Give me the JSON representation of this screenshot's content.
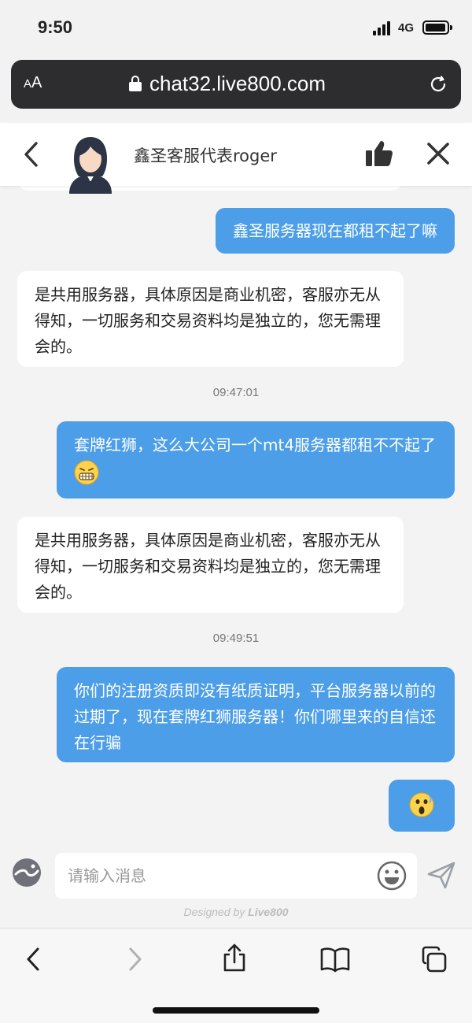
{
  "status_bar": {
    "time": "9:50",
    "network": "4G"
  },
  "browser": {
    "text_size_small": "A",
    "text_size_large": "A",
    "url": "chat32.live800.com"
  },
  "chat_header": {
    "agent_name": "鑫圣客服代表roger"
  },
  "messages": [
    {
      "direction": "out",
      "text": "鑫圣服务器现在都租不起了嘛"
    },
    {
      "direction": "in",
      "text": "是共用服务器，具体原因是商业机密，客服亦无从得知，一切服务和交易资料均是独立的，您无需理会的。"
    },
    {
      "type": "timestamp",
      "text": "09:47:01"
    },
    {
      "direction": "out",
      "text": "套牌红狮，这么大公司一个mt4服务器都租不不起了",
      "emoji": "grimacing-face"
    },
    {
      "direction": "in",
      "text": "是共用服务器，具体原因是商业机密，客服亦无从得知，一切服务和交易资料均是独立的，您无需理会的。"
    },
    {
      "type": "timestamp",
      "text": "09:49:51"
    },
    {
      "direction": "out",
      "text": "你们的注册资质即没有纸质证明，平台服务器以前的过期了，现在套牌红狮服务器！你们哪里来的自信还在行骗"
    },
    {
      "direction": "out",
      "text": "",
      "emoji": "shocked-face"
    }
  ],
  "input": {
    "placeholder": "请输入消息"
  },
  "branding": {
    "designed_by": "Designed by",
    "brand": "Live800"
  },
  "colors": {
    "outgoing_bubble": "#4c9ee8",
    "incoming_bubble": "#ffffff",
    "chat_background": "#f3f3f4"
  },
  "icons": [
    "back-chevron-icon",
    "agent-avatar",
    "thumbs-up-icon",
    "close-icon",
    "emoji-icon",
    "send-icon",
    "share-icon",
    "bookmarks-icon",
    "tabs-icon"
  ]
}
